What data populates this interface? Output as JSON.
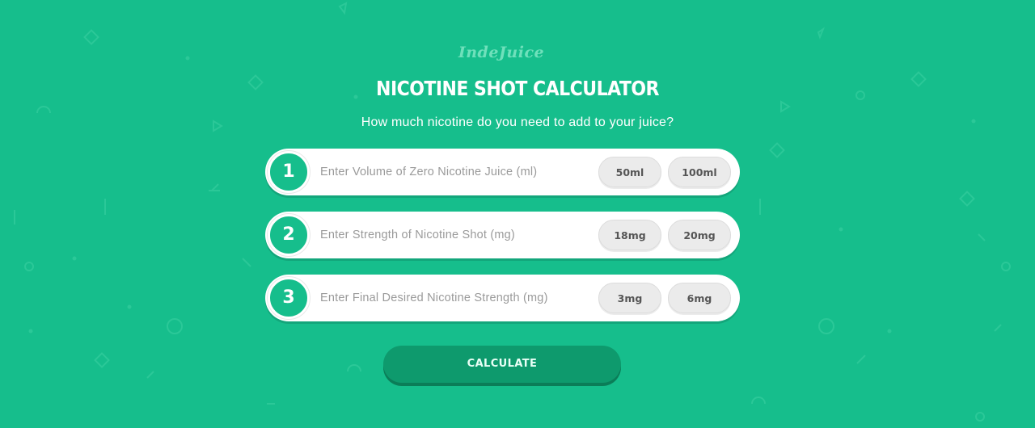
{
  "brand": {
    "logo_text": "IndeJuice"
  },
  "header": {
    "title": "NICOTINE SHOT CALCULATOR",
    "subtitle": "How much nicotine do you need to add to your juice?"
  },
  "steps": [
    {
      "number": "1",
      "placeholder": "Enter Volume of Zero Nicotine Juice (ml)",
      "value": "",
      "presets": [
        "50ml",
        "100ml"
      ]
    },
    {
      "number": "2",
      "placeholder": "Enter Strength of Nicotine Shot (mg)",
      "value": "",
      "presets": [
        "18mg",
        "20mg"
      ]
    },
    {
      "number": "3",
      "placeholder": "Enter Final Desired Nicotine Strength (mg)",
      "value": "",
      "presets": [
        "3mg",
        "6mg"
      ]
    }
  ],
  "actions": {
    "calculate_label": "CALCULATE"
  },
  "colors": {
    "background": "#16be8c",
    "button": "#0e9a6d",
    "card": "#ffffff",
    "preset": "#ebebeb"
  }
}
